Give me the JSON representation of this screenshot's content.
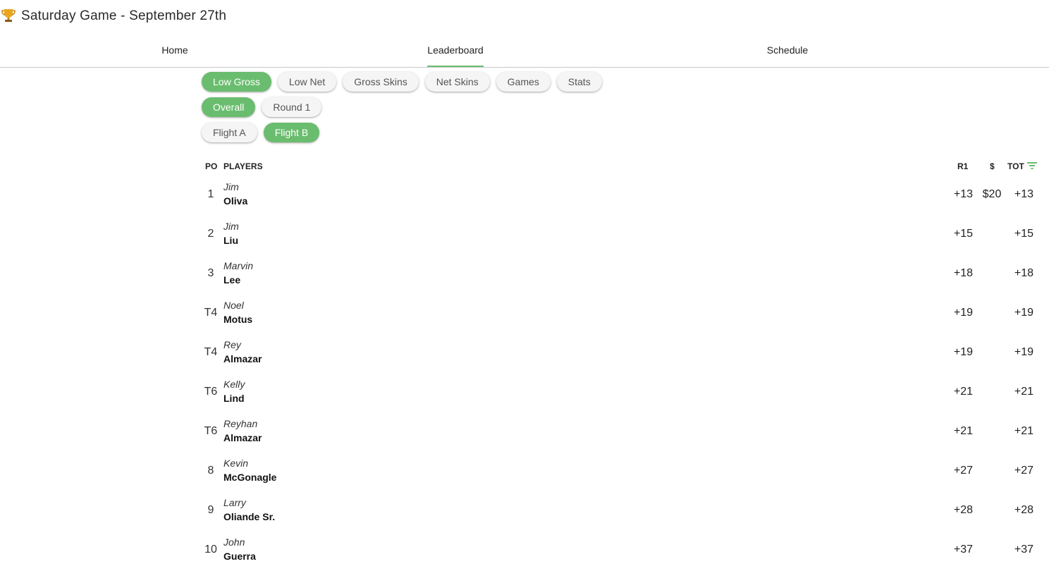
{
  "header": {
    "icon": "trophy-icon",
    "title": "Saturday Game - September 27th"
  },
  "nav": {
    "tabs": [
      {
        "label": "Home",
        "active": false
      },
      {
        "label": "Leaderboard",
        "active": true
      },
      {
        "label": "Schedule",
        "active": false
      }
    ]
  },
  "filters": {
    "category": [
      {
        "label": "Low Gross",
        "active": true
      },
      {
        "label": "Low Net",
        "active": false
      },
      {
        "label": "Gross Skins",
        "active": false
      },
      {
        "label": "Net Skins",
        "active": false
      },
      {
        "label": "Games",
        "active": false
      },
      {
        "label": "Stats",
        "active": false
      }
    ],
    "round": [
      {
        "label": "Overall",
        "active": true
      },
      {
        "label": "Round 1",
        "active": false
      }
    ],
    "flight": [
      {
        "label": "Flight A",
        "active": false
      },
      {
        "label": "Flight B",
        "active": true
      }
    ]
  },
  "table": {
    "columns": {
      "pos": "PO",
      "players": "PLAYERS",
      "r1": "R1",
      "money": "$",
      "tot": "TOT",
      "sort_icon": "sort-icon"
    },
    "rows": [
      {
        "pos": "1",
        "first": "Jim",
        "last": "Oliva",
        "r1": "+13",
        "money": "$20",
        "tot": "+13"
      },
      {
        "pos": "2",
        "first": "Jim",
        "last": "Liu",
        "r1": "+15",
        "money": "",
        "tot": "+15"
      },
      {
        "pos": "3",
        "first": "Marvin",
        "last": "Lee",
        "r1": "+18",
        "money": "",
        "tot": "+18"
      },
      {
        "pos": "T4",
        "first": "Noel",
        "last": "Motus",
        "r1": "+19",
        "money": "",
        "tot": "+19"
      },
      {
        "pos": "T4",
        "first": "Rey",
        "last": "Almazar",
        "r1": "+19",
        "money": "",
        "tot": "+19"
      },
      {
        "pos": "T6",
        "first": "Kelly",
        "last": "Lind",
        "r1": "+21",
        "money": "",
        "tot": "+21"
      },
      {
        "pos": "T6",
        "first": "Reyhan",
        "last": "Almazar",
        "r1": "+21",
        "money": "",
        "tot": "+21"
      },
      {
        "pos": "8",
        "first": "Kevin",
        "last": "McGonagle",
        "r1": "+27",
        "money": "",
        "tot": "+27"
      },
      {
        "pos": "9",
        "first": "Larry",
        "last": "Oliande Sr.",
        "r1": "+28",
        "money": "",
        "tot": "+28"
      },
      {
        "pos": "10",
        "first": "John",
        "last": "Guerra",
        "r1": "+37",
        "money": "",
        "tot": "+37"
      }
    ]
  },
  "colors": {
    "accent": "#6abd6e",
    "chip_inactive": "#f5f5f5",
    "divider": "#c8c8c8"
  }
}
